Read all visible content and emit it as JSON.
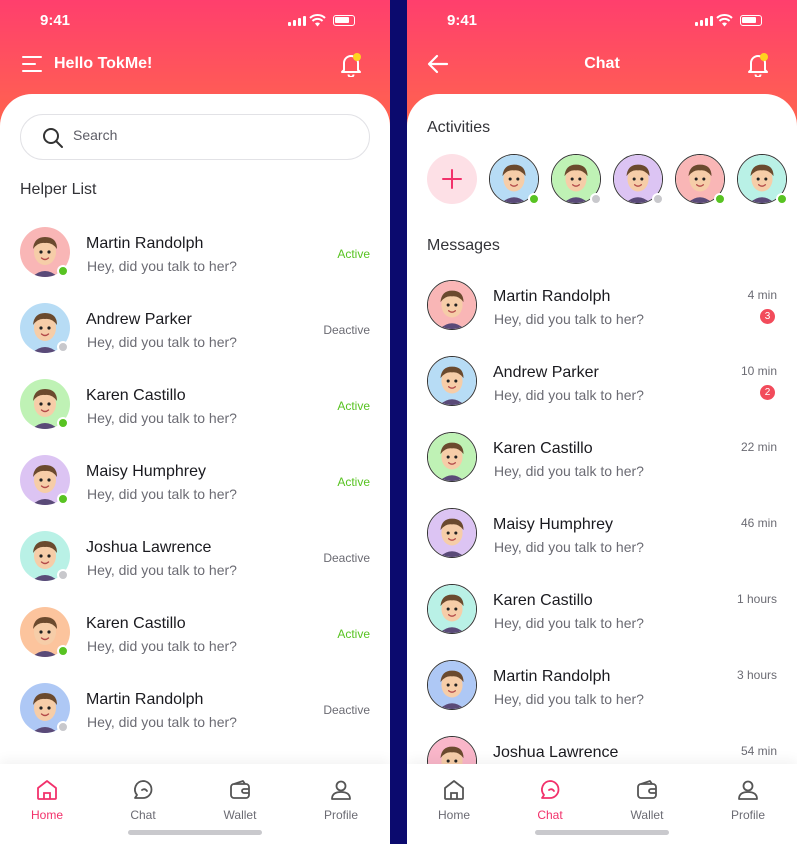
{
  "status": {
    "time": "9:41"
  },
  "colors": {
    "accent": "#f2316b",
    "active": "#58c322",
    "inactive": "#c8c8cc",
    "header_top": "#ff3f6d",
    "header_bottom": "#ff6a48"
  },
  "home": {
    "greeting": "Hello TokMe!",
    "search_placeholder": "Search",
    "section_title": "Helper List",
    "helpers": [
      {
        "name": "Martin Randolph",
        "message": "Hey, did you talk to her?",
        "status": "Active",
        "avatar_bg": "#f9b6b6"
      },
      {
        "name": "Andrew Parker",
        "message": "Hey, did you talk to her?",
        "status": "Deactive",
        "avatar_bg": "#b7dcf5"
      },
      {
        "name": "Karen Castillo",
        "message": "Hey, did you talk to her?",
        "status": "Active",
        "avatar_bg": "#bff2b5"
      },
      {
        "name": "Maisy Humphrey",
        "message": "Hey, did you talk to her?",
        "status": "Active",
        "avatar_bg": "#dcc4f3"
      },
      {
        "name": "Joshua Lawrence",
        "message": "Hey, did you talk to her?",
        "status": "Deactive",
        "avatar_bg": "#b9f1e6"
      },
      {
        "name": "Karen Castillo",
        "message": "Hey, did you talk to her?",
        "status": "Active",
        "avatar_bg": "#fcc49d"
      },
      {
        "name": "Martin Randolph",
        "message": "Hey, did you talk to her?",
        "status": "Deactive",
        "avatar_bg": "#aec8f5"
      }
    ]
  },
  "chat": {
    "title": "Chat",
    "activities_title": "Activities",
    "messages_title": "Messages",
    "activities": [
      {
        "avatar_bg": "#b7dcf5",
        "online": true
      },
      {
        "avatar_bg": "#bff2b5",
        "online": false
      },
      {
        "avatar_bg": "#dcc4f3",
        "online": false
      },
      {
        "avatar_bg": "#f9b6b6",
        "online": true
      },
      {
        "avatar_bg": "#b9f1e6",
        "online": true
      }
    ],
    "messages": [
      {
        "name": "Martin Randolph",
        "message": "Hey, did you talk to her?",
        "time": "4 min",
        "unread": "3",
        "avatar_bg": "#f9b6b6"
      },
      {
        "name": "Andrew Parker",
        "message": "Hey, did you talk to her?",
        "time": "10 min",
        "unread": "2",
        "avatar_bg": "#b7dcf5"
      },
      {
        "name": "Karen Castillo",
        "message": "Hey, did you talk to her?",
        "time": "22 min",
        "unread": "",
        "avatar_bg": "#bff2b5"
      },
      {
        "name": "Maisy Humphrey",
        "message": "Hey, did you talk to her?",
        "time": "46 min",
        "unread": "",
        "avatar_bg": "#dcc4f3"
      },
      {
        "name": "Karen Castillo",
        "message": "Hey, did you talk to her?",
        "time": "1 hours",
        "unread": "",
        "avatar_bg": "#b9f1e6"
      },
      {
        "name": "Martin Randolph",
        "message": "Hey, did you talk to her?",
        "time": "3 hours",
        "unread": "",
        "avatar_bg": "#aec8f5"
      },
      {
        "name": "Joshua Lawrence",
        "message": "",
        "time": "54 min",
        "unread": "",
        "avatar_bg": "#f9b6c9"
      }
    ]
  },
  "tabs": [
    {
      "label": "Home",
      "icon": "home-icon"
    },
    {
      "label": "Chat",
      "icon": "chat-icon"
    },
    {
      "label": "Wallet",
      "icon": "wallet-icon"
    },
    {
      "label": "Profile",
      "icon": "profile-icon"
    }
  ]
}
